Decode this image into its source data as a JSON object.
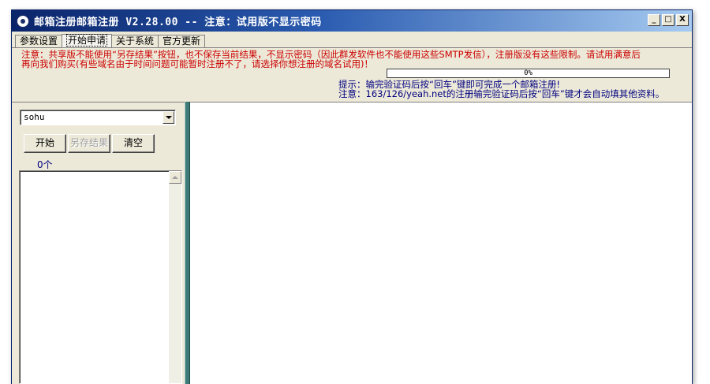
{
  "window": {
    "title": "邮箱注册邮箱注册 V2.28.00 -- 注意：试用版不显示密码",
    "controls": {
      "minimize": "_",
      "maximize": "□",
      "close": "X"
    }
  },
  "tabs": [
    {
      "label": "参数设置",
      "active": false
    },
    {
      "label": "开始申请",
      "active": true
    },
    {
      "label": "关于系统",
      "active": false
    },
    {
      "label": "官方更新",
      "active": false
    }
  ],
  "warning": {
    "line1": "注意：共享版不能使用“另存结果”按钮，也不保存当前结果，不显示密码（因此群发软件也不能使用这些SMTP发信），注册版没有这些限制。请试用满意后",
    "line2": "再向我们购买(有些域名由于时间问题可能暂时注册不了，请选择你想注册的域名试用)！",
    "color": "#cc0000"
  },
  "progress": {
    "label": "0%",
    "value": 0
  },
  "hints": {
    "line1": "提示：输完验证码后按“回车”键即可完成一个邮箱注册!",
    "line2": "注意：163/126/yeah.net的注册输完验证码后按“回车”键才会自动填其他资料。",
    "color": "#000080"
  },
  "left_panel": {
    "provider_select": {
      "value": "sohu"
    },
    "buttons": {
      "start": "开始",
      "save_as": "另存结果",
      "clear": "清空"
    },
    "count": "0个"
  },
  "colors": {
    "titlebar": "#0a246a",
    "splitter": "#3d7a78",
    "window_bg": "#ece9d8"
  }
}
